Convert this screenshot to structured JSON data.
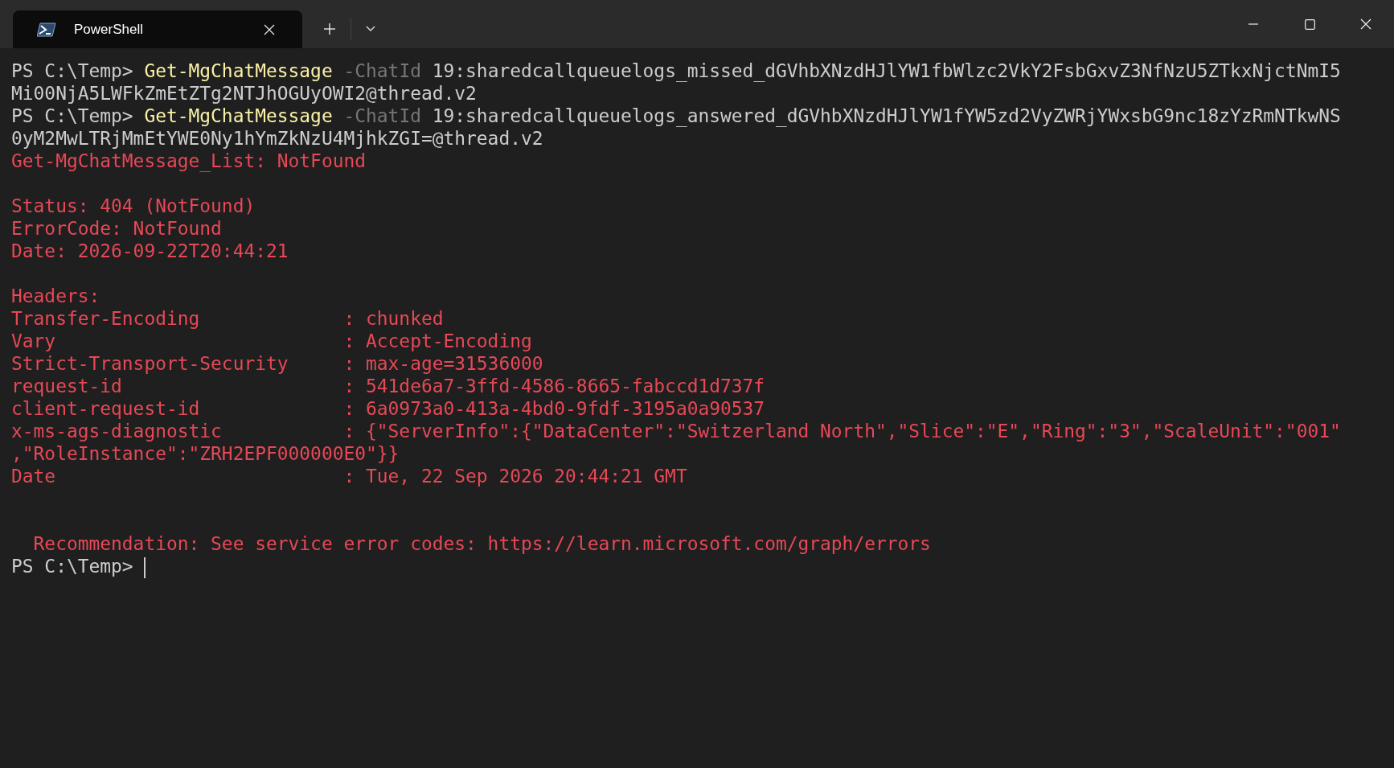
{
  "window": {
    "tabs": [
      {
        "title": "PowerShell",
        "selected": true
      }
    ]
  },
  "terminal": {
    "lines": [
      {
        "segments": [
          {
            "kind": "prompt",
            "text": "PS C:\\Temp>"
          },
          {
            "kind": "command",
            "text": "Get-MgChatMessage"
          },
          {
            "kind": "parameter",
            "text": "-ChatId"
          },
          {
            "kind": "argument",
            "text": "19:sharedcallqueuelogs_missed_dGVhbXNzdHJlYW1fbWlzc2VkY2FsbGxvZ3NfNzU5ZTkxNjctNmI5"
          }
        ]
      },
      {
        "segments": [
          {
            "kind": "argument",
            "text": "Mi00NjA5LWFkZmEtZTg2NTJhOGUyOWI2@thread.v2"
          }
        ]
      },
      {
        "segments": [
          {
            "kind": "prompt",
            "text": "PS C:\\Temp>"
          },
          {
            "kind": "command",
            "text": "Get-MgChatMessage"
          },
          {
            "kind": "parameter",
            "text": "-ChatId"
          },
          {
            "kind": "argument",
            "text": "19:sharedcallqueuelogs_answered_dGVhbXNzdHJlYW1fYW5zd2VyZWRjYWxsbG9nc18zYzRmNTkwNS"
          }
        ]
      },
      {
        "segments": [
          {
            "kind": "argument",
            "text": "0yM2MwLTRjMmEtYWE0Ny1hYmZkNzU4MjhkZGI=@thread.v2"
          }
        ]
      },
      {
        "segments": [
          {
            "kind": "error",
            "text": "Get-MgChatMessage_List: NotFound"
          }
        ]
      },
      {
        "kind": "blank"
      },
      {
        "segments": [
          {
            "kind": "error",
            "text": "Status: 404 (NotFound)"
          }
        ]
      },
      {
        "segments": [
          {
            "kind": "error",
            "text": "ErrorCode: NotFound"
          }
        ]
      },
      {
        "segments": [
          {
            "kind": "error",
            "text": "Date: 2026-09-22T20:44:21"
          }
        ]
      },
      {
        "kind": "blank"
      },
      {
        "segments": [
          {
            "kind": "error",
            "text": "Headers:"
          }
        ]
      },
      {
        "segments": [
          {
            "kind": "error",
            "text": "Transfer-Encoding             : chunked"
          }
        ]
      },
      {
        "segments": [
          {
            "kind": "error",
            "text": "Vary                          : Accept-Encoding"
          }
        ]
      },
      {
        "segments": [
          {
            "kind": "error",
            "text": "Strict-Transport-Security     : max-age=31536000"
          }
        ]
      },
      {
        "segments": [
          {
            "kind": "error",
            "text": "request-id                    : 541de6a7-3ffd-4586-8665-fabccd1d737f"
          }
        ]
      },
      {
        "segments": [
          {
            "kind": "error",
            "text": "client-request-id             : 6a0973a0-413a-4bd0-9fdf-3195a0a90537"
          }
        ]
      },
      {
        "segments": [
          {
            "kind": "error",
            "text": "x-ms-ags-diagnostic           : {\"ServerInfo\":{\"DataCenter\":\"Switzerland North\",\"Slice\":\"E\",\"Ring\":\"3\",\"ScaleUnit\":\"001\""
          }
        ]
      },
      {
        "segments": [
          {
            "kind": "error",
            "text": ",\"RoleInstance\":\"ZRH2EPF000000E0\"}}"
          }
        ]
      },
      {
        "segments": [
          {
            "kind": "error",
            "text": "Date                          : Tue, 22 Sep 2026 20:44:21 GMT"
          }
        ]
      },
      {
        "kind": "blank"
      },
      {
        "kind": "blank"
      },
      {
        "indent": true,
        "segments": [
          {
            "kind": "error",
            "text": "Recommendation: See service error codes: https://learn.microsoft.com/graph/errors"
          }
        ]
      },
      {
        "cursor": true,
        "segments": [
          {
            "kind": "prompt",
            "text": "PS C:\\Temp>"
          }
        ]
      }
    ]
  }
}
